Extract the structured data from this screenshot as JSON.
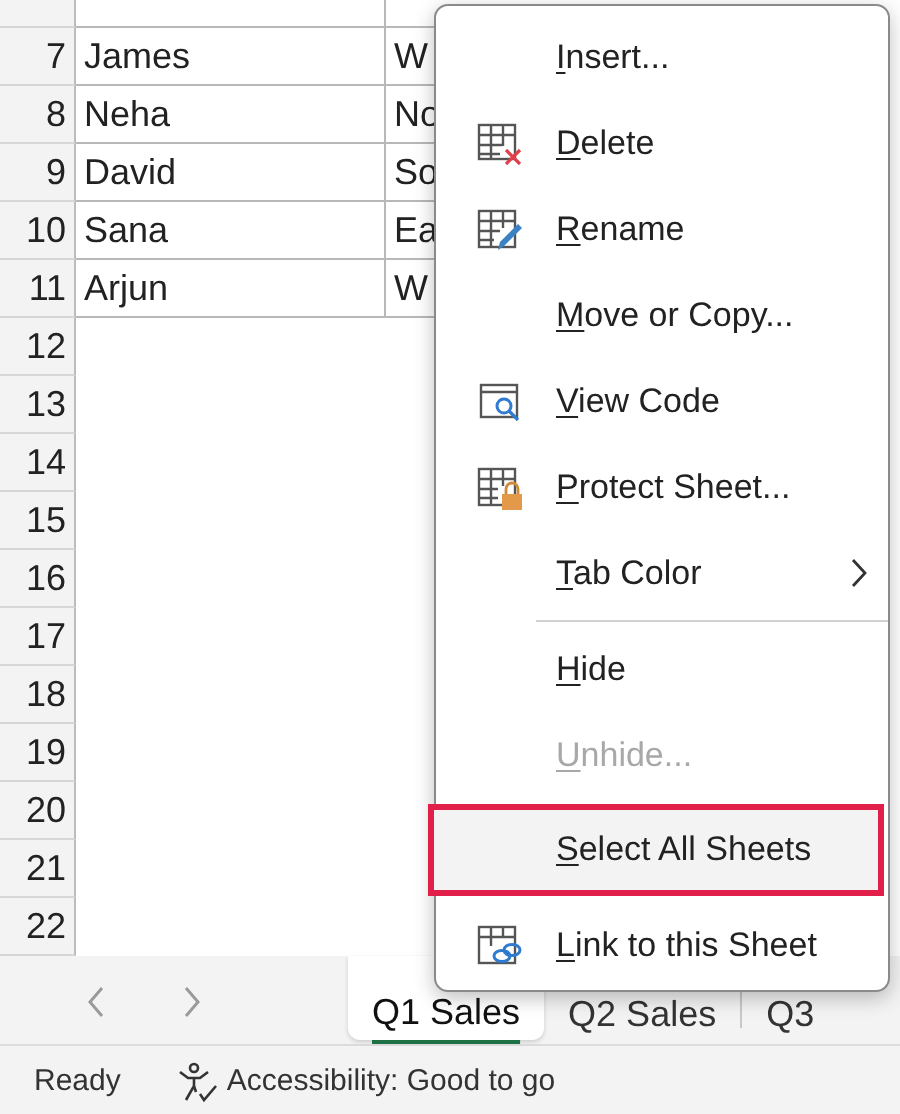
{
  "sheet": {
    "rows": [
      {
        "number": "7",
        "cells": [
          "James",
          "W"
        ]
      },
      {
        "number": "8",
        "cells": [
          "Neha",
          "No"
        ]
      },
      {
        "number": "9",
        "cells": [
          "David",
          "So"
        ]
      },
      {
        "number": "10",
        "cells": [
          "Sana",
          "Ea"
        ]
      },
      {
        "number": "11",
        "cells": [
          "Arjun",
          "W"
        ]
      },
      {
        "number": "12",
        "cells": []
      },
      {
        "number": "13",
        "cells": []
      },
      {
        "number": "14",
        "cells": []
      },
      {
        "number": "15",
        "cells": []
      },
      {
        "number": "16",
        "cells": []
      },
      {
        "number": "17",
        "cells": []
      },
      {
        "number": "18",
        "cells": []
      },
      {
        "number": "19",
        "cells": []
      },
      {
        "number": "20",
        "cells": []
      },
      {
        "number": "21",
        "cells": []
      },
      {
        "number": "22",
        "cells": []
      }
    ]
  },
  "context_menu": {
    "items": [
      {
        "kind": "item",
        "label": "Insert...",
        "disabled": false,
        "highlighted": false,
        "submenu": false
      },
      {
        "kind": "item",
        "label": "Delete",
        "disabled": false,
        "highlighted": false,
        "submenu": false
      },
      {
        "kind": "item",
        "label": "Rename",
        "disabled": false,
        "highlighted": false,
        "submenu": false
      },
      {
        "kind": "item",
        "label": "Move or Copy...",
        "disabled": false,
        "highlighted": false,
        "submenu": false
      },
      {
        "kind": "item",
        "label": "View Code",
        "disabled": false,
        "highlighted": false,
        "submenu": false
      },
      {
        "kind": "item",
        "label": "Protect Sheet...",
        "disabled": false,
        "highlighted": false,
        "submenu": false
      },
      {
        "kind": "item",
        "label": "Tab Color",
        "disabled": false,
        "highlighted": false,
        "submenu": true
      },
      {
        "kind": "separator"
      },
      {
        "kind": "item",
        "label": "Hide",
        "disabled": false,
        "highlighted": false,
        "submenu": false
      },
      {
        "kind": "item",
        "label": "Unhide...",
        "disabled": true,
        "highlighted": false,
        "submenu": false
      },
      {
        "kind": "item",
        "label": "Select All Sheets",
        "disabled": false,
        "highlighted": true,
        "submenu": false
      },
      {
        "kind": "item",
        "label": "Link to this Sheet",
        "disabled": false,
        "highlighted": false,
        "submenu": false
      }
    ]
  },
  "sheet_tabs": [
    {
      "label": "Q1 Sales",
      "selected": true
    },
    {
      "label": "Q2 Sales",
      "selected": false
    },
    {
      "label": "Q3",
      "selected": false
    }
  ],
  "status_bar": {
    "mode": "Ready",
    "accessibility": "Accessibility: Good to go"
  }
}
